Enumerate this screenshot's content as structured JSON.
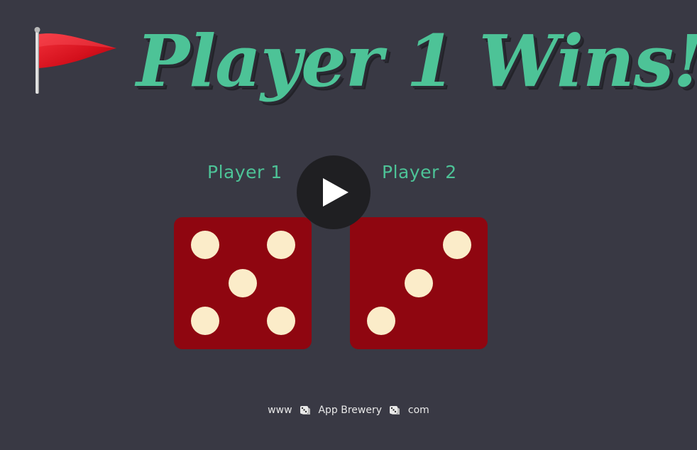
{
  "header": {
    "title": "Player 1 Wins!",
    "icon": "red-flag-icon"
  },
  "players": [
    {
      "label": "Player 1",
      "die_value": 5
    },
    {
      "label": "Player 2",
      "die_value": 3
    }
  ],
  "overlay": {
    "icon": "play-icon"
  },
  "footer": {
    "part1": "www",
    "part2": "App Brewery",
    "part3": "com",
    "separator_icon": "dice-icon"
  },
  "colors": {
    "background": "#393944",
    "accent": "#4dc397",
    "die": "#8f0610",
    "pip": "#fbecc9"
  }
}
